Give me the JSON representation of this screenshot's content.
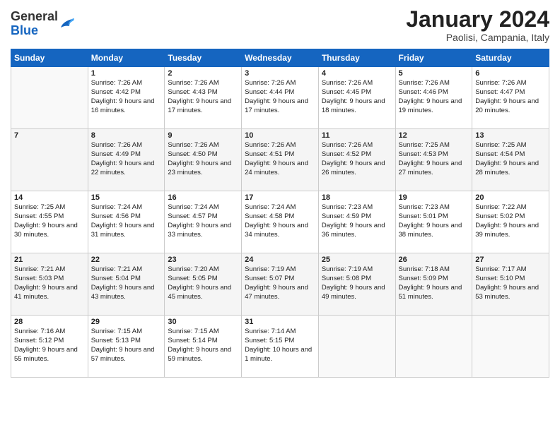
{
  "header": {
    "logo": {
      "general": "General",
      "blue": "Blue"
    },
    "title": "January 2024",
    "location": "Paolisi, Campania, Italy"
  },
  "days_of_week": [
    "Sunday",
    "Monday",
    "Tuesday",
    "Wednesday",
    "Thursday",
    "Friday",
    "Saturday"
  ],
  "weeks": [
    [
      {
        "day": "",
        "info": ""
      },
      {
        "day": "1",
        "info": "Sunrise: 7:26 AM\nSunset: 4:42 PM\nDaylight: 9 hours\nand 16 minutes."
      },
      {
        "day": "2",
        "info": "Sunrise: 7:26 AM\nSunset: 4:43 PM\nDaylight: 9 hours\nand 17 minutes."
      },
      {
        "day": "3",
        "info": "Sunrise: 7:26 AM\nSunset: 4:44 PM\nDaylight: 9 hours\nand 17 minutes."
      },
      {
        "day": "4",
        "info": "Sunrise: 7:26 AM\nSunset: 4:45 PM\nDaylight: 9 hours\nand 18 minutes."
      },
      {
        "day": "5",
        "info": "Sunrise: 7:26 AM\nSunset: 4:46 PM\nDaylight: 9 hours\nand 19 minutes."
      },
      {
        "day": "6",
        "info": "Sunrise: 7:26 AM\nSunset: 4:47 PM\nDaylight: 9 hours\nand 20 minutes."
      }
    ],
    [
      {
        "day": "7",
        "info": ""
      },
      {
        "day": "8",
        "info": "Sunrise: 7:26 AM\nSunset: 4:49 PM\nDaylight: 9 hours\nand 22 minutes."
      },
      {
        "day": "9",
        "info": "Sunrise: 7:26 AM\nSunset: 4:50 PM\nDaylight: 9 hours\nand 23 minutes."
      },
      {
        "day": "10",
        "info": "Sunrise: 7:26 AM\nSunset: 4:51 PM\nDaylight: 9 hours\nand 24 minutes."
      },
      {
        "day": "11",
        "info": "Sunrise: 7:26 AM\nSunset: 4:52 PM\nDaylight: 9 hours\nand 26 minutes."
      },
      {
        "day": "12",
        "info": "Sunrise: 7:25 AM\nSunset: 4:53 PM\nDaylight: 9 hours\nand 27 minutes."
      },
      {
        "day": "13",
        "info": "Sunrise: 7:25 AM\nSunset: 4:54 PM\nDaylight: 9 hours\nand 28 minutes."
      }
    ],
    [
      {
        "day": "14",
        "info": "Sunrise: 7:25 AM\nSunset: 4:55 PM\nDaylight: 9 hours\nand 30 minutes."
      },
      {
        "day": "15",
        "info": "Sunrise: 7:24 AM\nSunset: 4:56 PM\nDaylight: 9 hours\nand 31 minutes."
      },
      {
        "day": "16",
        "info": "Sunrise: 7:24 AM\nSunset: 4:57 PM\nDaylight: 9 hours\nand 33 minutes."
      },
      {
        "day": "17",
        "info": "Sunrise: 7:24 AM\nSunset: 4:58 PM\nDaylight: 9 hours\nand 34 minutes."
      },
      {
        "day": "18",
        "info": "Sunrise: 7:23 AM\nSunset: 4:59 PM\nDaylight: 9 hours\nand 36 minutes."
      },
      {
        "day": "19",
        "info": "Sunrise: 7:23 AM\nSunset: 5:01 PM\nDaylight: 9 hours\nand 38 minutes."
      },
      {
        "day": "20",
        "info": "Sunrise: 7:22 AM\nSunset: 5:02 PM\nDaylight: 9 hours\nand 39 minutes."
      }
    ],
    [
      {
        "day": "21",
        "info": "Sunrise: 7:21 AM\nSunset: 5:03 PM\nDaylight: 9 hours\nand 41 minutes."
      },
      {
        "day": "22",
        "info": "Sunrise: 7:21 AM\nSunset: 5:04 PM\nDaylight: 9 hours\nand 43 minutes."
      },
      {
        "day": "23",
        "info": "Sunrise: 7:20 AM\nSunset: 5:05 PM\nDaylight: 9 hours\nand 45 minutes."
      },
      {
        "day": "24",
        "info": "Sunrise: 7:19 AM\nSunset: 5:07 PM\nDaylight: 9 hours\nand 47 minutes."
      },
      {
        "day": "25",
        "info": "Sunrise: 7:19 AM\nSunset: 5:08 PM\nDaylight: 9 hours\nand 49 minutes."
      },
      {
        "day": "26",
        "info": "Sunrise: 7:18 AM\nSunset: 5:09 PM\nDaylight: 9 hours\nand 51 minutes."
      },
      {
        "day": "27",
        "info": "Sunrise: 7:17 AM\nSunset: 5:10 PM\nDaylight: 9 hours\nand 53 minutes."
      }
    ],
    [
      {
        "day": "28",
        "info": "Sunrise: 7:16 AM\nSunset: 5:12 PM\nDaylight: 9 hours\nand 55 minutes."
      },
      {
        "day": "29",
        "info": "Sunrise: 7:15 AM\nSunset: 5:13 PM\nDaylight: 9 hours\nand 57 minutes."
      },
      {
        "day": "30",
        "info": "Sunrise: 7:15 AM\nSunset: 5:14 PM\nDaylight: 9 hours\nand 59 minutes."
      },
      {
        "day": "31",
        "info": "Sunrise: 7:14 AM\nSunset: 5:15 PM\nDaylight: 10 hours\nand 1 minute."
      },
      {
        "day": "",
        "info": ""
      },
      {
        "day": "",
        "info": ""
      },
      {
        "day": "",
        "info": ""
      }
    ]
  ]
}
